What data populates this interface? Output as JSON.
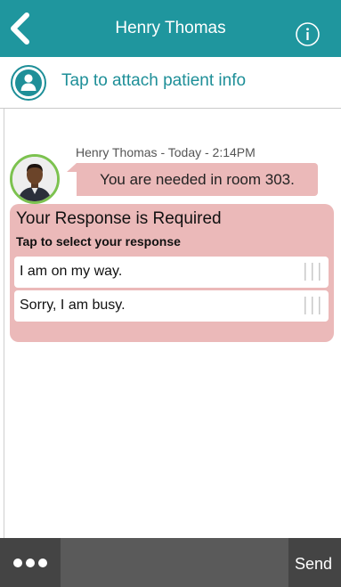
{
  "header": {
    "title": "Henry Thomas",
    "back_icon": "back-chevron-icon",
    "info_icon": "info-icon",
    "bg_color": "#1f969e"
  },
  "attach": {
    "label": "Tap to attach patient info",
    "icon": "patient-icon"
  },
  "message": {
    "meta": "Henry Thomas - Today - 2:14PM",
    "text": "You are needed in room 303.",
    "bubble_color": "#ebb9b9",
    "avatar_border_color": "#7cc24f"
  },
  "response": {
    "title": "Your Response is Required",
    "subtitle": "Tap to select your response",
    "options": [
      {
        "label": "I am on my way."
      },
      {
        "label": "Sorry, I am busy."
      }
    ]
  },
  "composer": {
    "more_icon": "more-dots-icon",
    "input_value": "",
    "send_label": "Send"
  }
}
